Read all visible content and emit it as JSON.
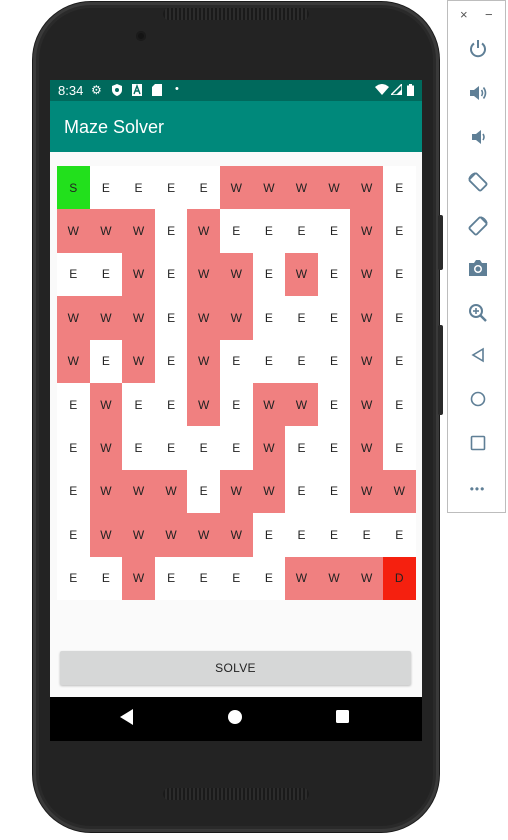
{
  "status_bar": {
    "time": "8:34",
    "left_icons": [
      "gear-icon",
      "shield-icon",
      "a-icon",
      "sd-card-icon",
      "dot-icon"
    ],
    "right_icons": [
      "wifi-icon",
      "signal-icon",
      "battery-icon"
    ]
  },
  "app_bar": {
    "title": "Maze Solver"
  },
  "maze": {
    "colors": {
      "wall": "#f08080",
      "start": "#22e01c",
      "destination": "#f5200f",
      "empty": "#ffffff"
    },
    "rows": [
      [
        "S",
        "E",
        "E",
        "E",
        "E",
        "W",
        "W",
        "W",
        "W",
        "W",
        "E"
      ],
      [
        "W",
        "W",
        "W",
        "E",
        "W",
        "E",
        "E",
        "E",
        "E",
        "W",
        "E"
      ],
      [
        "E",
        "E",
        "W",
        "E",
        "W",
        "W",
        "E",
        "W",
        "E",
        "W",
        "E"
      ],
      [
        "W",
        "W",
        "W",
        "E",
        "W",
        "W",
        "E",
        "E",
        "E",
        "W",
        "E"
      ],
      [
        "W",
        "E",
        "W",
        "E",
        "W",
        "E",
        "E",
        "E",
        "E",
        "W",
        "E"
      ],
      [
        "E",
        "W",
        "E",
        "E",
        "W",
        "E",
        "W",
        "W",
        "E",
        "W",
        "E"
      ],
      [
        "E",
        "W",
        "E",
        "E",
        "E",
        "E",
        "W",
        "E",
        "E",
        "W",
        "E"
      ],
      [
        "E",
        "W",
        "W",
        "W",
        "E",
        "W",
        "W",
        "E",
        "E",
        "W",
        "W"
      ],
      [
        "E",
        "W",
        "W",
        "W",
        "W",
        "W",
        "E",
        "E",
        "E",
        "E",
        "E"
      ],
      [
        "E",
        "E",
        "W",
        "E",
        "E",
        "E",
        "E",
        "W",
        "W",
        "W",
        "D"
      ]
    ]
  },
  "solve_button": {
    "label": "SOLVE"
  },
  "nav_bar": {
    "icons": [
      "back-icon",
      "home-icon",
      "recents-icon"
    ]
  },
  "emulator_toolbar": {
    "window_controls": {
      "close": "×",
      "minimize": "−"
    },
    "buttons": [
      "power-icon",
      "volume-up-icon",
      "volume-down-icon",
      "rotate-left-icon",
      "rotate-right-icon",
      "camera-icon",
      "zoom-icon",
      "back-icon",
      "home-icon",
      "overview-icon",
      "more-icon"
    ],
    "more_label": "•••"
  }
}
